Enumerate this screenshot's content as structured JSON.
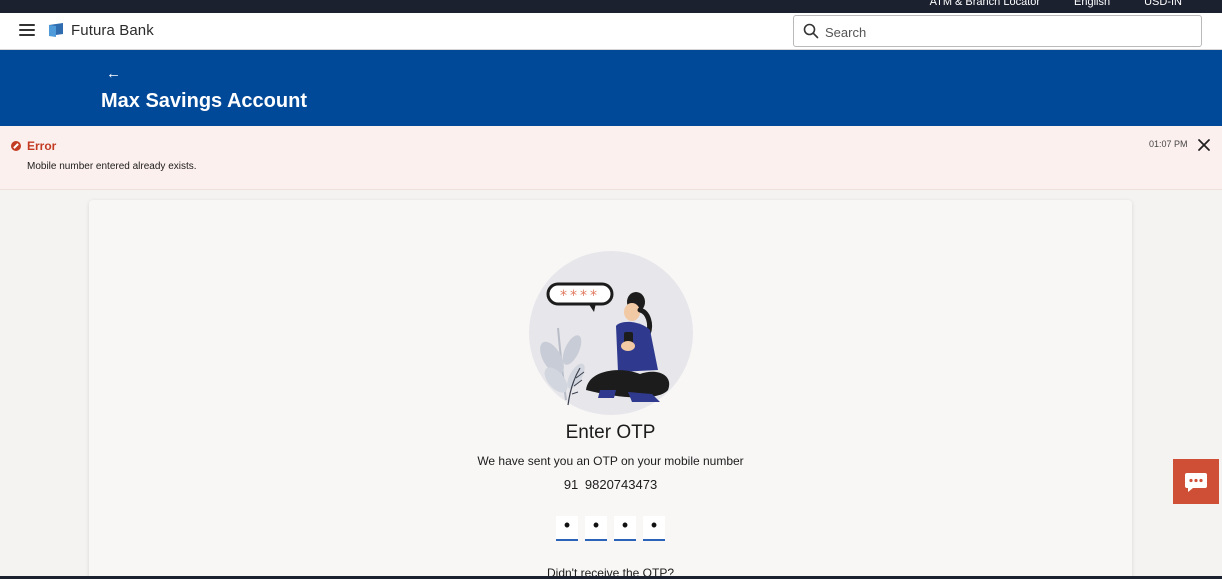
{
  "topbar": {
    "links": [
      "ATM & Branch Locator",
      "English",
      "USD-IN"
    ]
  },
  "header": {
    "brand": "Futura Bank",
    "search_placeholder": "Search"
  },
  "banner": {
    "back_label": "←",
    "title": "Max Savings Account"
  },
  "error": {
    "title": "Error",
    "message": "Mobile number entered already exists.",
    "time": "01:07 PM"
  },
  "otp": {
    "title": "Enter OTP",
    "subtitle": "We have sent you an OTP on your mobile number",
    "phone": "91  9820743473",
    "digits": [
      "•",
      "•",
      "•",
      "•"
    ],
    "resend_prompt": "Didn't receive the OTP?"
  },
  "colors": {
    "brand_blue": "#004898",
    "error_red": "#c23b22",
    "accent_orange": "#cf4f36",
    "otp_underline": "#2a63b8"
  },
  "icons": [
    "hamburger-menu-icon",
    "bank-logo-icon",
    "search-icon",
    "back-arrow-icon",
    "error-icon",
    "close-icon",
    "otp-illustration",
    "chat-icon"
  ]
}
